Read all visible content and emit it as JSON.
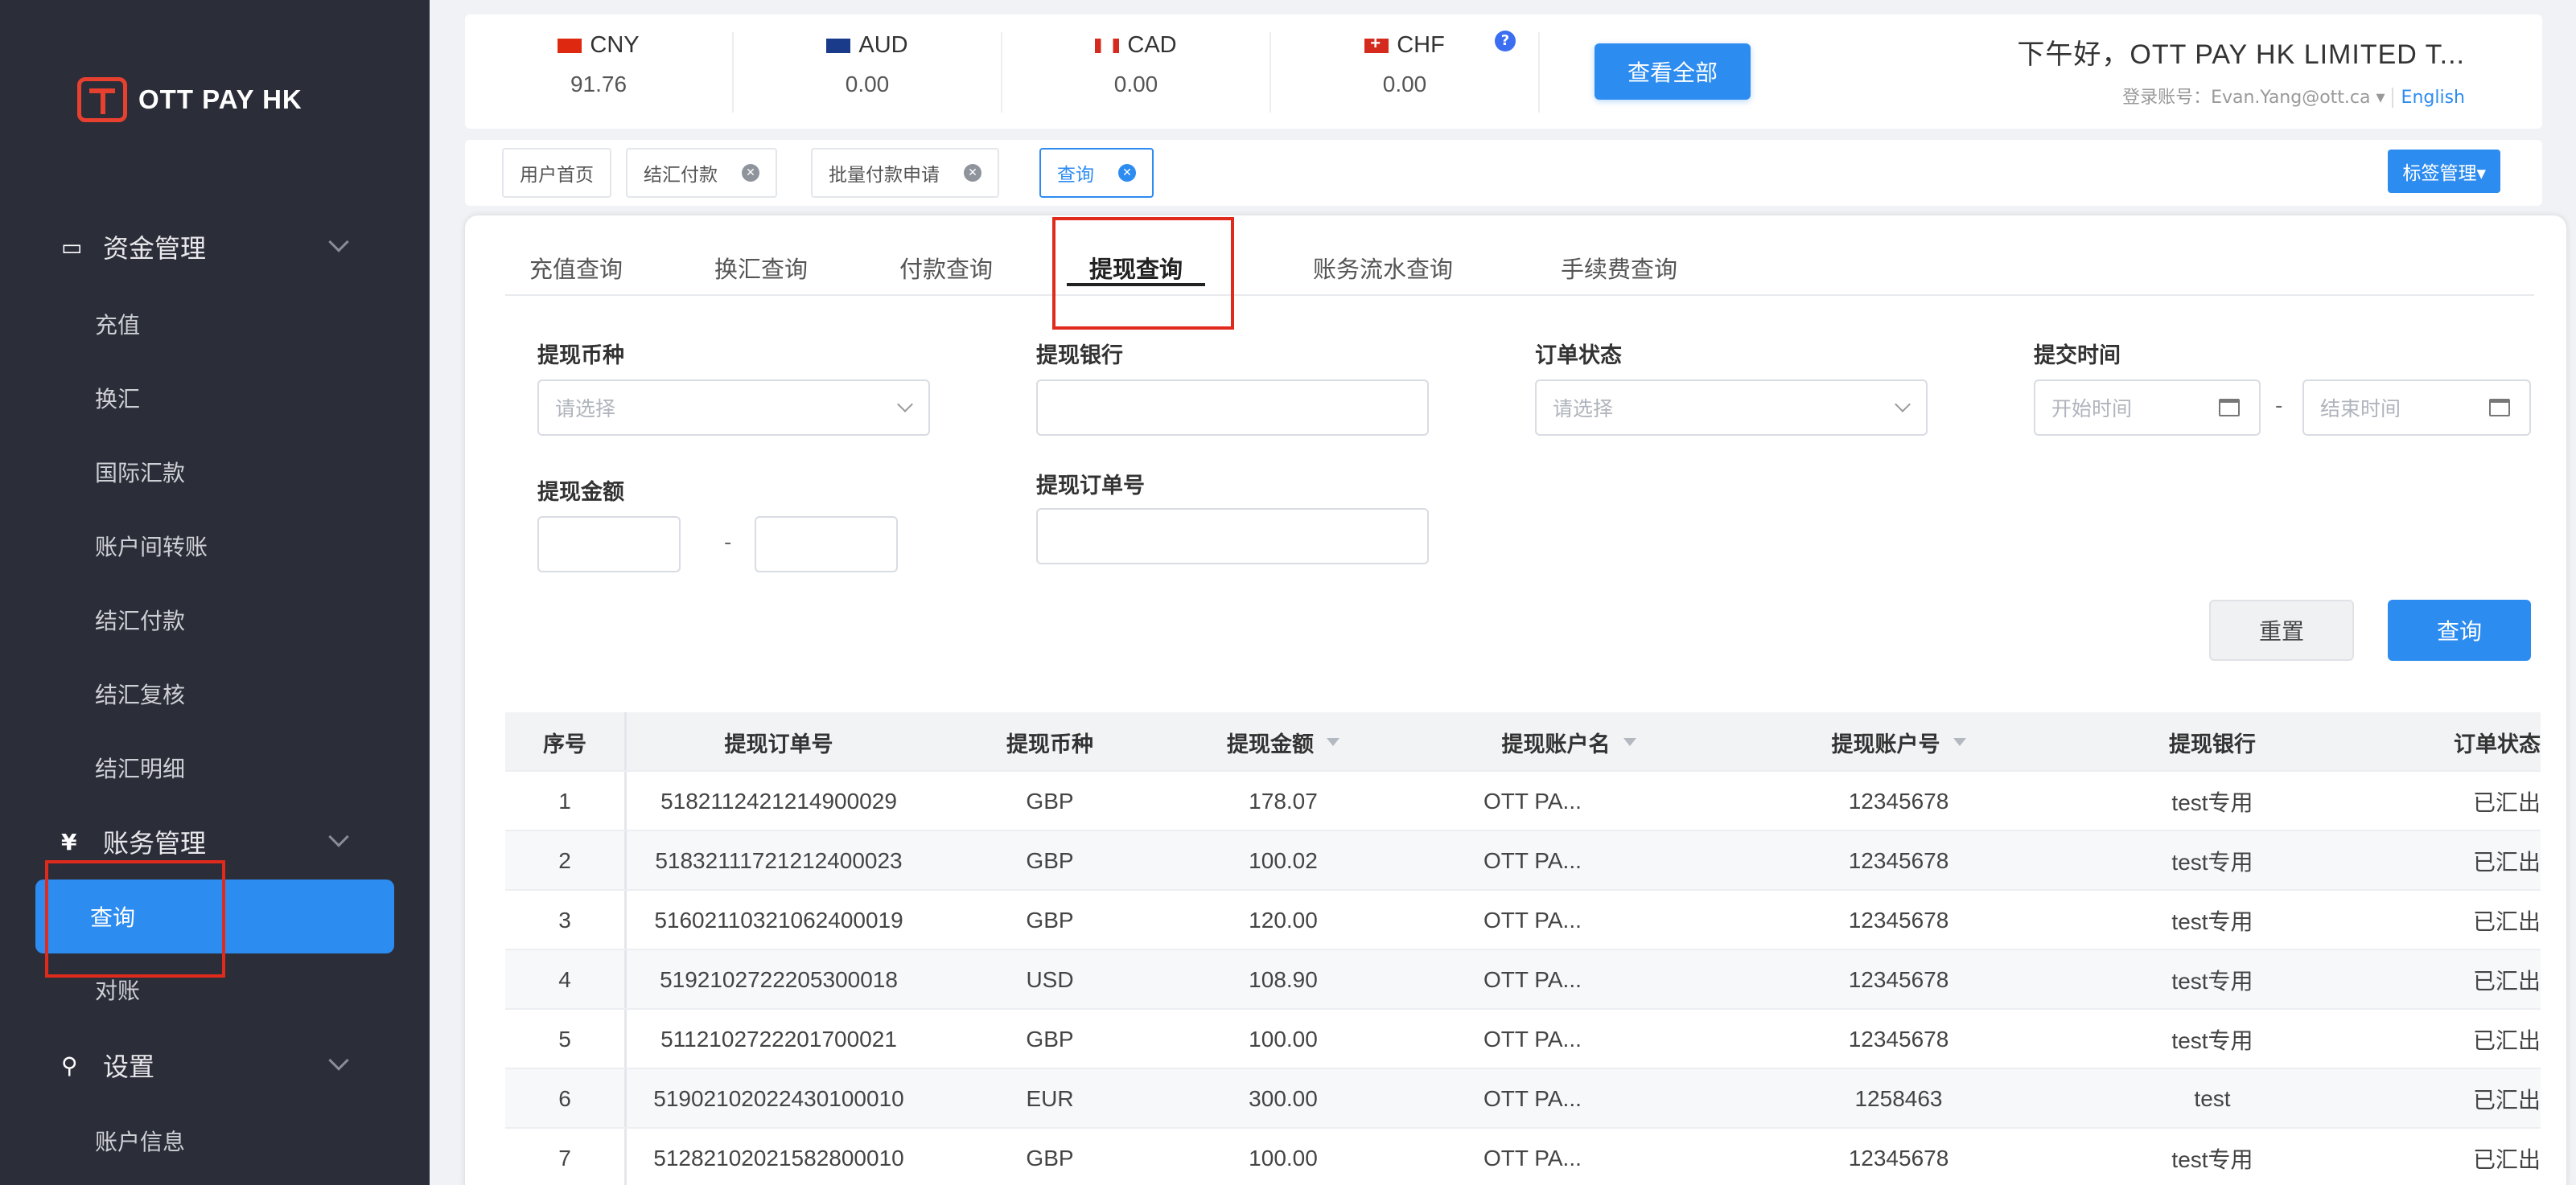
{
  "brand": {
    "name": "OTT PAY HK",
    "color": "#e8402f"
  },
  "sidebar": {
    "groups": [
      {
        "icon": "credit-card-icon",
        "glyph": "▭",
        "label": "资金管理"
      },
      {
        "icon": "yen-icon",
        "glyph": "¥",
        "label": "账务管理"
      },
      {
        "icon": "search-icon",
        "glyph": "⚲",
        "label": "设置"
      }
    ],
    "items": [
      "充值",
      "换汇",
      "国际汇款",
      "账户间转账",
      "结汇付款",
      "结汇复核",
      "结汇明细",
      "查询",
      "对账",
      "账户信息"
    ],
    "active_item": "查询"
  },
  "balances": [
    {
      "code": "CNY",
      "amount": "91.76",
      "flag": "china-flag-icon"
    },
    {
      "code": "AUD",
      "amount": "0.00",
      "flag": "australia-flag-icon"
    },
    {
      "code": "CAD",
      "amount": "0.00",
      "flag": "canada-flag-icon"
    },
    {
      "code": "CHF",
      "amount": "0.00",
      "flag": "switzerland-flag-icon"
    }
  ],
  "help_glyph": "?",
  "view_all_label": "查看全部",
  "greeting": "下午好，OTT PAY HK LIMITED T...",
  "account_label": "登录账号：Evan.Yang@ott.ca",
  "account_caret": "▾",
  "language": "English",
  "tags": [
    {
      "label": "用户首页",
      "closable": false
    },
    {
      "label": "结汇付款",
      "closable": true
    },
    {
      "label": "批量付款申请",
      "closable": true
    },
    {
      "label": "查询",
      "closable": true,
      "active": true
    }
  ],
  "close_glyph": "✕",
  "tag_manage_label": "标签管理▾",
  "tabs": [
    "充值查询",
    "换汇查询",
    "付款查询",
    "提现查询",
    "账务流水查询",
    "手续费查询"
  ],
  "active_tab": "提现查询",
  "filters": {
    "currency": {
      "label": "提现币种",
      "placeholder": "请选择"
    },
    "bank": {
      "label": "提现银行",
      "value": ""
    },
    "status": {
      "label": "订单状态",
      "placeholder": "请选择"
    },
    "submit_time": {
      "label": "提交时间",
      "start_placeholder": "开始时间",
      "end_placeholder": "结束时间"
    },
    "amount": {
      "label": "提现金额",
      "min": "",
      "max": ""
    },
    "order_no": {
      "label": "提现订单号",
      "value": ""
    },
    "range_sep": "-"
  },
  "buttons": {
    "reset": "重置",
    "query": "查询"
  },
  "table": {
    "columns": [
      "序号",
      "提现订单号",
      "提现币种",
      "提现金额",
      "提现账户名",
      "提现账户号",
      "提现银行",
      "订单状态"
    ],
    "rows": [
      [
        "1",
        "5182112421214900029",
        "GBP",
        "178.07",
        "OTT PA...",
        "12345678",
        "test专用",
        "已汇出"
      ],
      [
        "2",
        "5183211172121240002​3",
        "GBP",
        "100.02",
        "OTT PA...",
        "12345678",
        "test专用",
        "已汇出"
      ],
      [
        "3",
        "5160211032106240001​9",
        "GBP",
        "120.00",
        "OTT PA...",
        "12345678",
        "test专用",
        "已汇出"
      ],
      [
        "4",
        "5192102722205300018",
        "USD",
        "108.90",
        "OTT PA...",
        "12345678",
        "test专用",
        "已汇出"
      ],
      [
        "5",
        "5112102722201700021",
        "GBP",
        "100.00",
        "OTT PA...",
        "12345678",
        "test专用",
        "已汇出"
      ],
      [
        "6",
        "5190210202243010001​0",
        "EUR",
        "300.00",
        "OTT PA...",
        "1258463",
        "test",
        "已汇出"
      ],
      [
        "7",
        "5128210202158280001​0",
        "GBP",
        "100.00",
        "OTT PA...",
        "12345678",
        "test专用",
        "已汇出"
      ]
    ]
  },
  "colors": {
    "sidebar_bg": "#2b2d38",
    "accent": "#2d8cf0",
    "annotation": "#e02b1c"
  }
}
